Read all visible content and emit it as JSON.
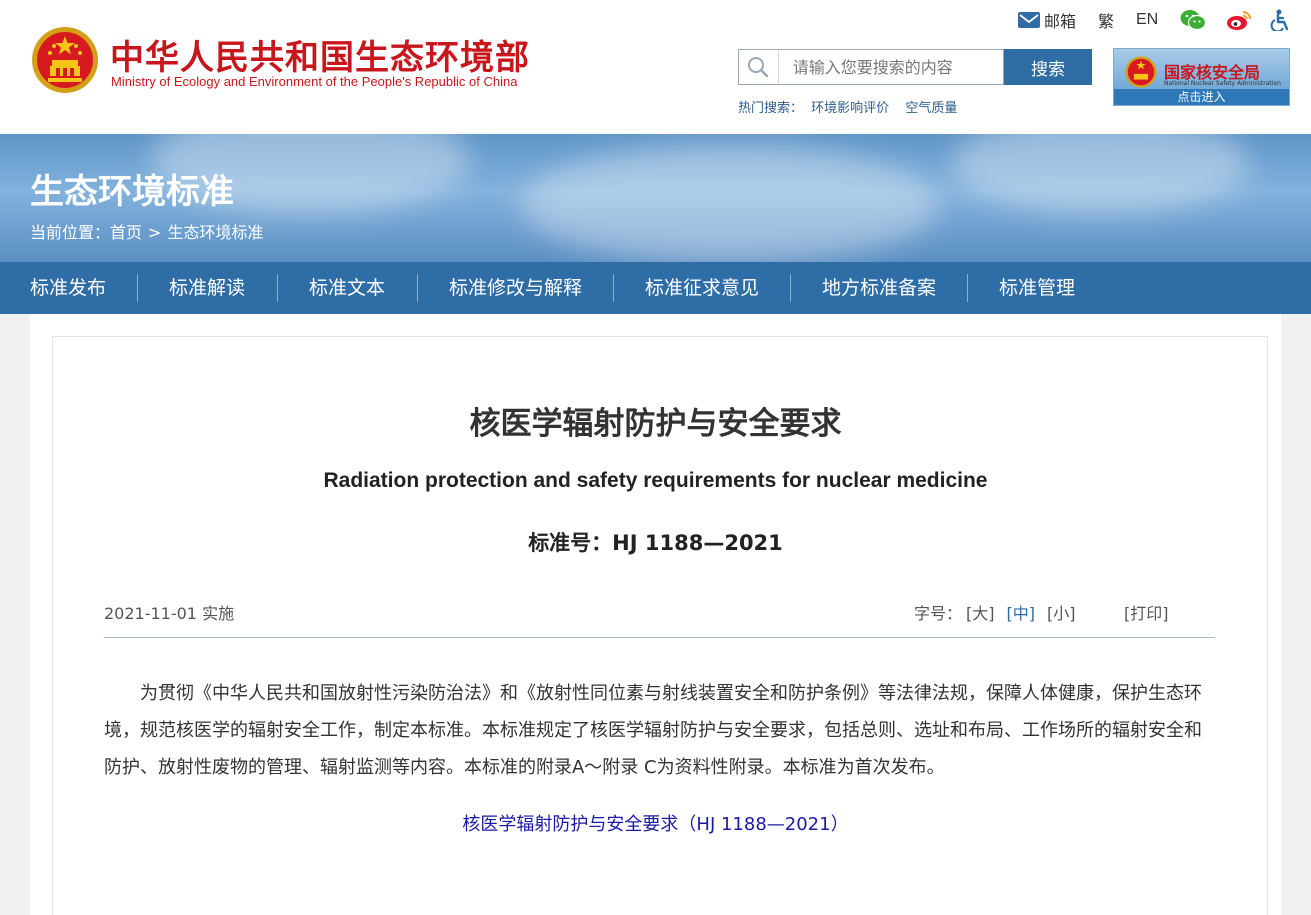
{
  "header": {
    "site_name_cn": "中华人民共和国生态环境部",
    "site_name_en": "Ministry of Ecology and Environment of the People's Republic of China",
    "util": {
      "mail": "邮箱",
      "traditional": "繁",
      "english": "EN"
    },
    "search": {
      "placeholder": "请输入您要搜索的内容",
      "button": "搜索"
    },
    "hot": {
      "label": "热门搜索：",
      "items": [
        "环境影响评价",
        "空气质量"
      ]
    },
    "nnsa": {
      "name": "国家核安全局",
      "sub": "National Nuclear Safety Administration",
      "enter": "点击进入"
    }
  },
  "banner": {
    "title": "生态环境标准",
    "breadcrumb": {
      "label": "当前位置：",
      "home": "首页",
      "sep": ">",
      "current": "生态环境标准"
    }
  },
  "nav": [
    "标准发布",
    "标准解读",
    "标准文本",
    "标准修改与解释",
    "标准征求意见",
    "地方标准备案",
    "标准管理"
  ],
  "article": {
    "title_cn": "核医学辐射防护与安全要求",
    "title_en": "Radiation protection and safety requirements for nuclear medicine",
    "standard_no": "标准号：HJ 1188—2021",
    "date": "2021-11-01 实施",
    "font_size": {
      "label": "字号：",
      "large": "[大]",
      "medium": "[中]",
      "small": "[小]"
    },
    "print": "[打印]",
    "body": "为贯彻《中华人民共和国放射性污染防治法》和《放射性同位素与射线装置安全和防护条例》等法律法规，保障人体健康，保护生态环境，规范核医学的辐射安全工作，制定本标准。本标准规定了核医学辐射防护与安全要求，包括总则、选址和布局、工作场所的辐射安全和防护、放射性废物的管理、辐射监测等内容。本标准的附录A～附录 C为资料性附录。本标准为首次发布。",
    "link": "核医学辐射防护与安全要求（HJ 1188—2021）"
  },
  "colors": {
    "brand_red": "#c8161d",
    "nav_blue": "#2f6da6",
    "link_blue": "#1a1aa6"
  }
}
